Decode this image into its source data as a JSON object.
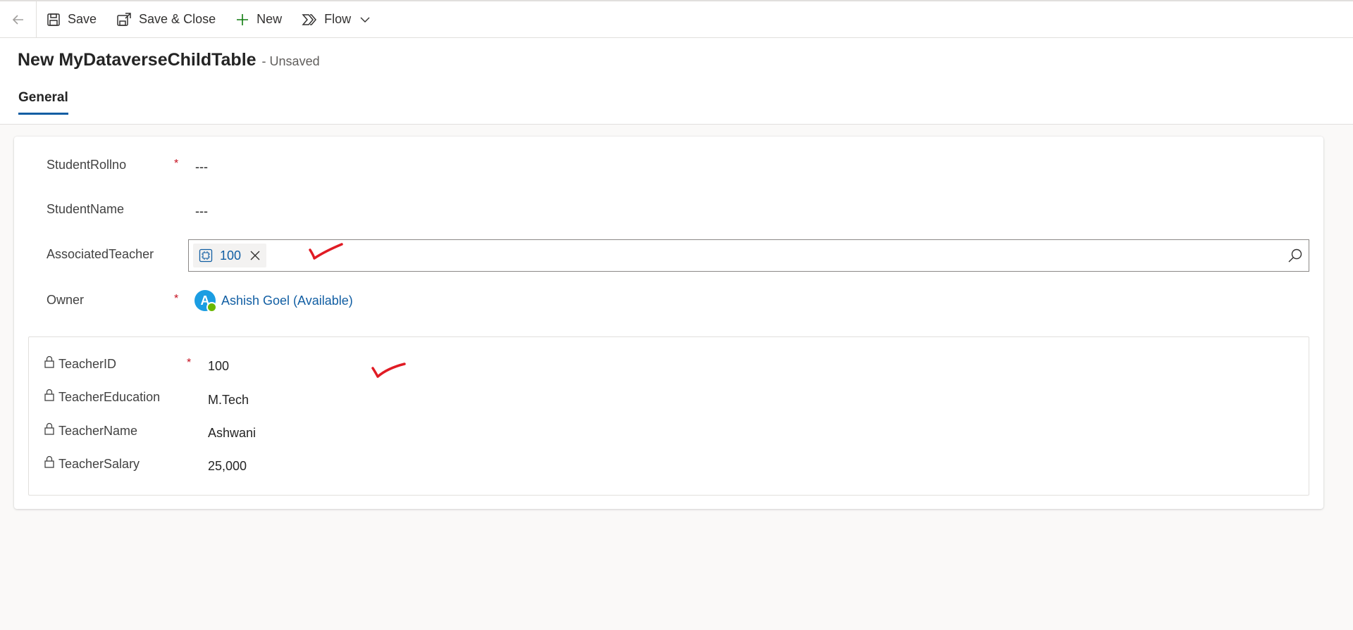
{
  "toolbar": {
    "save_label": "Save",
    "save_close_label": "Save & Close",
    "new_label": "New",
    "flow_label": "Flow"
  },
  "header": {
    "title": "New MyDataverseChildTable",
    "status": "- Unsaved",
    "tabs": [
      {
        "label": "General"
      }
    ]
  },
  "form": {
    "fields": [
      {
        "label": "StudentRollno",
        "required": true,
        "value": "---"
      },
      {
        "label": "StudentName",
        "required": false,
        "value": "---"
      },
      {
        "label": "AssociatedTeacher",
        "required": false,
        "lookup_value": "100"
      },
      {
        "label": "Owner",
        "required": true,
        "value": "Ashish Goel (Available)",
        "avatar_initial": "A"
      }
    ],
    "required_marker": "*"
  },
  "quick_view": {
    "fields": [
      {
        "label": "TeacherID",
        "required": true,
        "value": "100"
      },
      {
        "label": "TeacherEducation",
        "required": false,
        "value": "M.Tech"
      },
      {
        "label": "TeacherName",
        "required": false,
        "value": "Ashwani"
      },
      {
        "label": "TeacherSalary",
        "required": false,
        "value": "25,000"
      }
    ]
  },
  "colors": {
    "accent": "#115ea3",
    "required": "#c50f1f",
    "presence": "#6bb700",
    "annotation": "#e01b24"
  },
  "icons": [
    "back-arrow-icon",
    "save-icon",
    "save-close-icon",
    "plus-icon",
    "flow-icon",
    "chevron-down-icon",
    "entity-icon",
    "close-icon",
    "search-icon",
    "lock-icon"
  ]
}
